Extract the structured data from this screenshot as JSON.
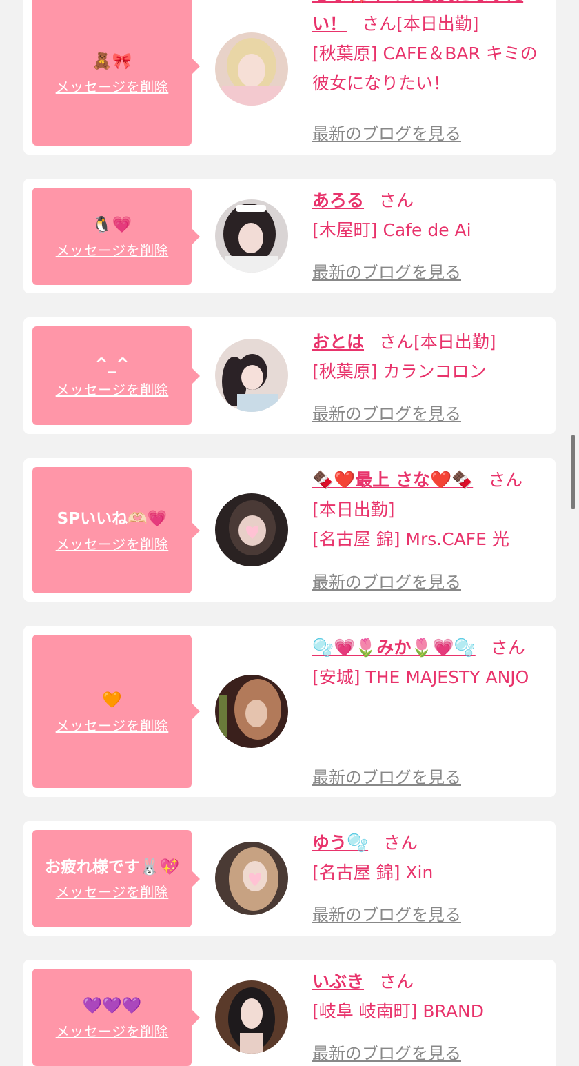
{
  "labels": {
    "delete": "メッセージを削除",
    "blog": "最新のブログを見る",
    "honorific": "さん"
  },
  "cards": [
    {
      "message": "🧸🎀",
      "name": "もな🎀キミの彼女になりたい！",
      "status": "[本日出勤]",
      "shop": "[秋葉原] CAFE＆BAR キミの彼女になりたい！",
      "avatar_icon": "avatar-photo-blonde"
    },
    {
      "message": "🐧💗",
      "name": "あろる",
      "status": "",
      "shop": "[木屋町] Cafe de Ai",
      "avatar_icon": "avatar-photo-maid"
    },
    {
      "message": "^_^",
      "name": "おとは",
      "status": "[本日出勤]",
      "shop": "[秋葉原] カランコロン",
      "avatar_icon": "avatar-photo-twintails"
    },
    {
      "message": "SPいいね🫶🏻💗",
      "name": "🍫❤️最上 さな❤️🍫",
      "status": "[本日出勤]",
      "shop": "[名古屋 錦] Mrs.CAFE 光",
      "avatar_icon": "avatar-photo-heart-face"
    },
    {
      "message": "🧡",
      "name": "🫧💗🌷みか🌷💗🫧",
      "status": "",
      "shop": "[安城] THE MAJESTY ANJO",
      "avatar_icon": "avatar-photo-brown-hair"
    },
    {
      "message": "お疲れ様です🐰💖",
      "name": "ゆう🫧",
      "status": "",
      "shop": "[名古屋 錦] Xin",
      "avatar_icon": "avatar-photo-heart-face"
    },
    {
      "message": "💜💜💜",
      "name": "いぶき",
      "status": "",
      "shop": "[岐阜 岐南町] BRAND",
      "avatar_icon": "avatar-photo-black-hair"
    }
  ],
  "colors": {
    "accent": "#e8336b",
    "bubble": "#ff96a8",
    "link_gray": "#888888",
    "background": "#f2f2f2"
  }
}
